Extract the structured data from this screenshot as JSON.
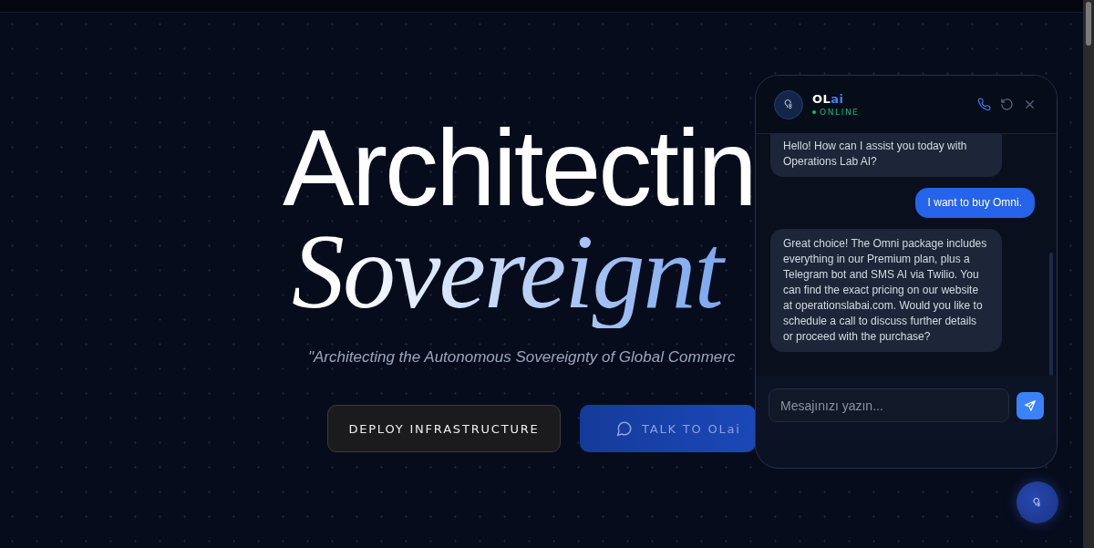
{
  "hero": {
    "title_line_1": "Architectin",
    "title_line_2": "Sovereignt",
    "tagline": "\"Architecting the Autonomous Sovereignty of Global Commerc"
  },
  "buttons": [
    {
      "label": "DEPLOY INFRASTRUCTURE",
      "kind": "dark"
    },
    {
      "label": "TALK TO OLai",
      "kind": "accent"
    }
  ],
  "chat": {
    "name_main": "OL",
    "name_accent": "ai",
    "status": "ONLINE",
    "online": true,
    "messages": [
      {
        "kind": "bot",
        "text": "Hello! How can I assist you today with Operations Lab AI?"
      },
      {
        "kind": "user",
        "text": "I want to buy Omni."
      },
      {
        "kind": "bot",
        "text": "Great choice! The Omni package includes everything in our Premium plan, plus a Telegram bot and SMS AI via Twilio. You can find the exact pricing on our website at operationslabai.com. Would you like to schedule a call to discuss further details or proceed with the purchase?"
      }
    ],
    "input": {
      "placeholder": "Mesajınızı yazın..."
    }
  }
}
